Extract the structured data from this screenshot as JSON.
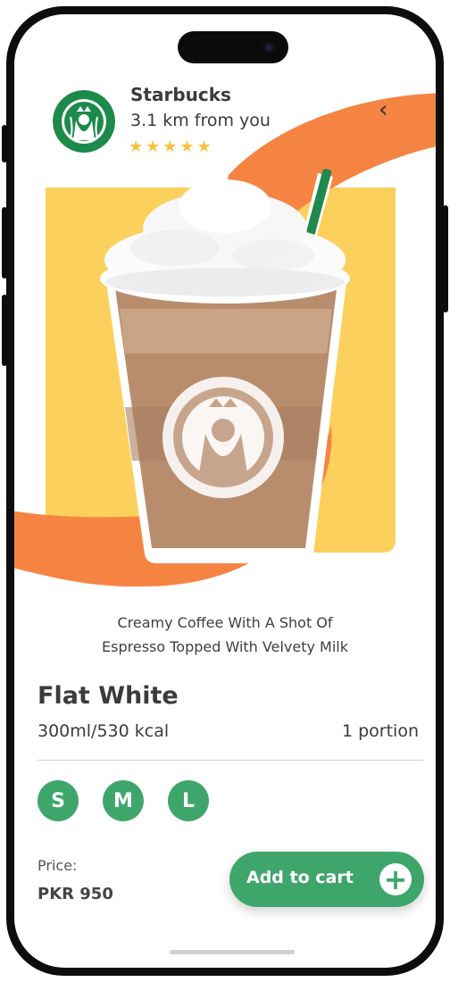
{
  "header": {
    "brand": "Starbucks",
    "distance": "3.1 km from you",
    "rating_stars": "★★★★★",
    "rating": 5
  },
  "product": {
    "description_line1": "Creamy Coffee With A Shot Of",
    "description_line2": "Espresso Topped With Velvety Milk",
    "name": "Flat White",
    "volume_kcal": "300ml/530 kcal",
    "portion": "1 portion",
    "sizes": [
      "S",
      "M",
      "L"
    ]
  },
  "price": {
    "label": "Price:",
    "value": "PKR 950"
  },
  "cart_button": {
    "label": "Add to cart",
    "plus": "+"
  },
  "icons": {
    "back": "‹"
  },
  "colors": {
    "accent_green": "#3ea66b",
    "swoosh_orange": "#f58443",
    "panel_yellow": "#fcd05d",
    "star_yellow": "#f6c23e"
  }
}
